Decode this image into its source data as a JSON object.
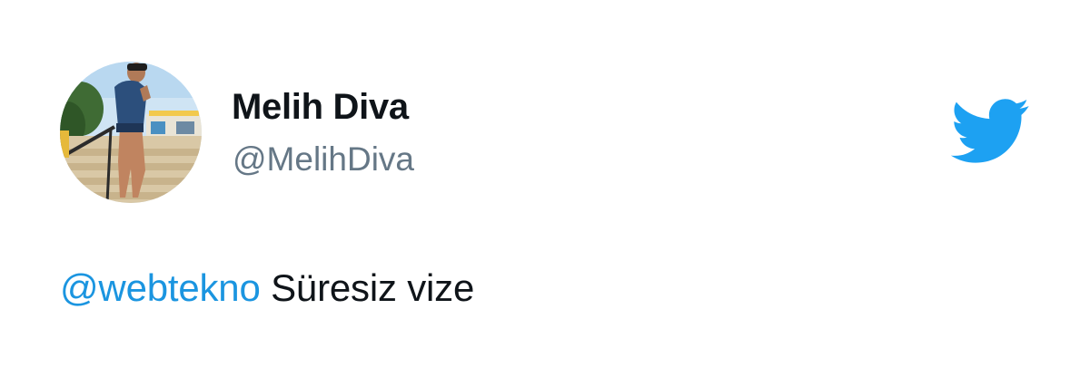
{
  "user": {
    "display_name": "Melih Diva",
    "handle": "@MelihDiva"
  },
  "tweet": {
    "mention": "@webtekno",
    "text": " Süresiz vize"
  },
  "icons": {
    "logo": "twitter-bird-icon",
    "avatar": "profile-photo"
  },
  "colors": {
    "brand": "#1da1f2",
    "mention": "#1b95e0",
    "handle": "#657786",
    "text": "#0f1419"
  }
}
